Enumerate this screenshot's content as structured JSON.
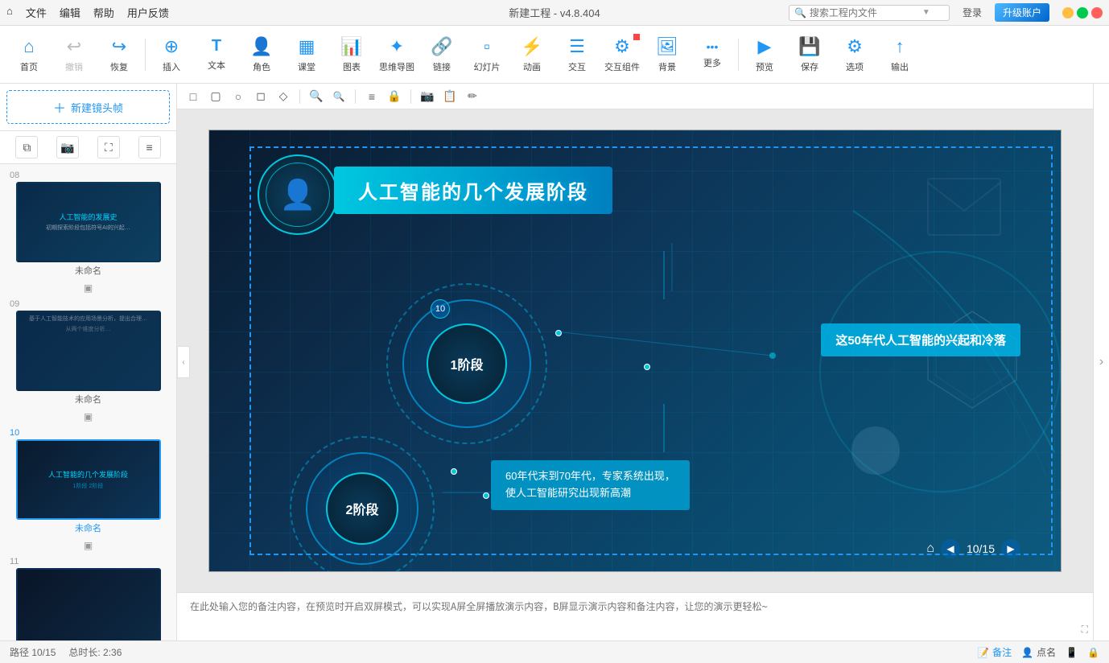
{
  "titlebar": {
    "menu": [
      "文件",
      "编辑",
      "帮助",
      "用户反馈"
    ],
    "title": "新建工程 - v4.8.404",
    "search_placeholder": "搜索工程内文件",
    "login_label": "登录",
    "upgrade_label": "升级账户"
  },
  "toolbar": {
    "items": [
      {
        "id": "home",
        "label": "首页",
        "icon": "⌂"
      },
      {
        "id": "undo",
        "label": "撤销",
        "icon": "↩"
      },
      {
        "id": "redo",
        "label": "恢复",
        "icon": "↪"
      },
      {
        "id": "insert",
        "label": "插入",
        "icon": "⊕"
      },
      {
        "id": "text",
        "label": "文本",
        "icon": "T"
      },
      {
        "id": "role",
        "label": "角色",
        "icon": "👤"
      },
      {
        "id": "class",
        "label": "课堂",
        "icon": "▦"
      },
      {
        "id": "chart",
        "label": "图表",
        "icon": "📊"
      },
      {
        "id": "mindmap",
        "label": "思维导图",
        "icon": "✦"
      },
      {
        "id": "link",
        "label": "链接",
        "icon": "🔗"
      },
      {
        "id": "slides",
        "label": "幻灯片",
        "icon": "▪"
      },
      {
        "id": "animation",
        "label": "动画",
        "icon": "⚡"
      },
      {
        "id": "interact",
        "label": "交互",
        "icon": "☰"
      },
      {
        "id": "interact2",
        "label": "交互组件",
        "icon": "⚙"
      },
      {
        "id": "bg",
        "label": "背景",
        "icon": "🖼"
      },
      {
        "id": "more",
        "label": "更多",
        "icon": "···"
      },
      {
        "id": "preview",
        "label": "预览",
        "icon": "▶"
      },
      {
        "id": "save",
        "label": "保存",
        "icon": "💾"
      },
      {
        "id": "options",
        "label": "选项",
        "icon": "⚙"
      },
      {
        "id": "export",
        "label": "输出",
        "icon": "↑"
      }
    ]
  },
  "canvas_toolbar": {
    "tools": [
      "□",
      "□",
      "□",
      "□",
      "□",
      "🔍+",
      "🔍-",
      "≡",
      "🔒",
      "📷",
      "📋",
      "✏"
    ]
  },
  "sidebar": {
    "new_frame_label": "新建镜头帧",
    "slides": [
      {
        "number": "08",
        "name": "未命名",
        "active": false
      },
      {
        "number": "09",
        "name": "未命名",
        "active": false
      },
      {
        "number": "10",
        "name": "未命名",
        "active": true
      },
      {
        "number": "11",
        "name": "",
        "active": false
      }
    ]
  },
  "canvas": {
    "title": "人工智能的几个发展阶段",
    "stage1_label": "1阶段",
    "stage2_label": "2阶段",
    "info1": "这50年代人工智能的兴起和冷落",
    "info2": "60年代末到70年代，专家系统出现，\n使人工智能研究出现新高潮",
    "number_badge": "10",
    "page_counter": "10/15"
  },
  "notes": {
    "placeholder": "在此处输入您的备注内容，在预览时开启双屏模式，可以实现A屏全屏播放演示内容，B屏显示演示内容和备注内容，让您的演示更轻松~"
  },
  "statusbar": {
    "path": "路径 10/15",
    "duration": "总时长: 2:36",
    "notes_label": "备注",
    "callout_label": "点名",
    "icon1": "📝",
    "icon2": "👤",
    "icon3": "📱",
    "icon4": "🔒"
  }
}
